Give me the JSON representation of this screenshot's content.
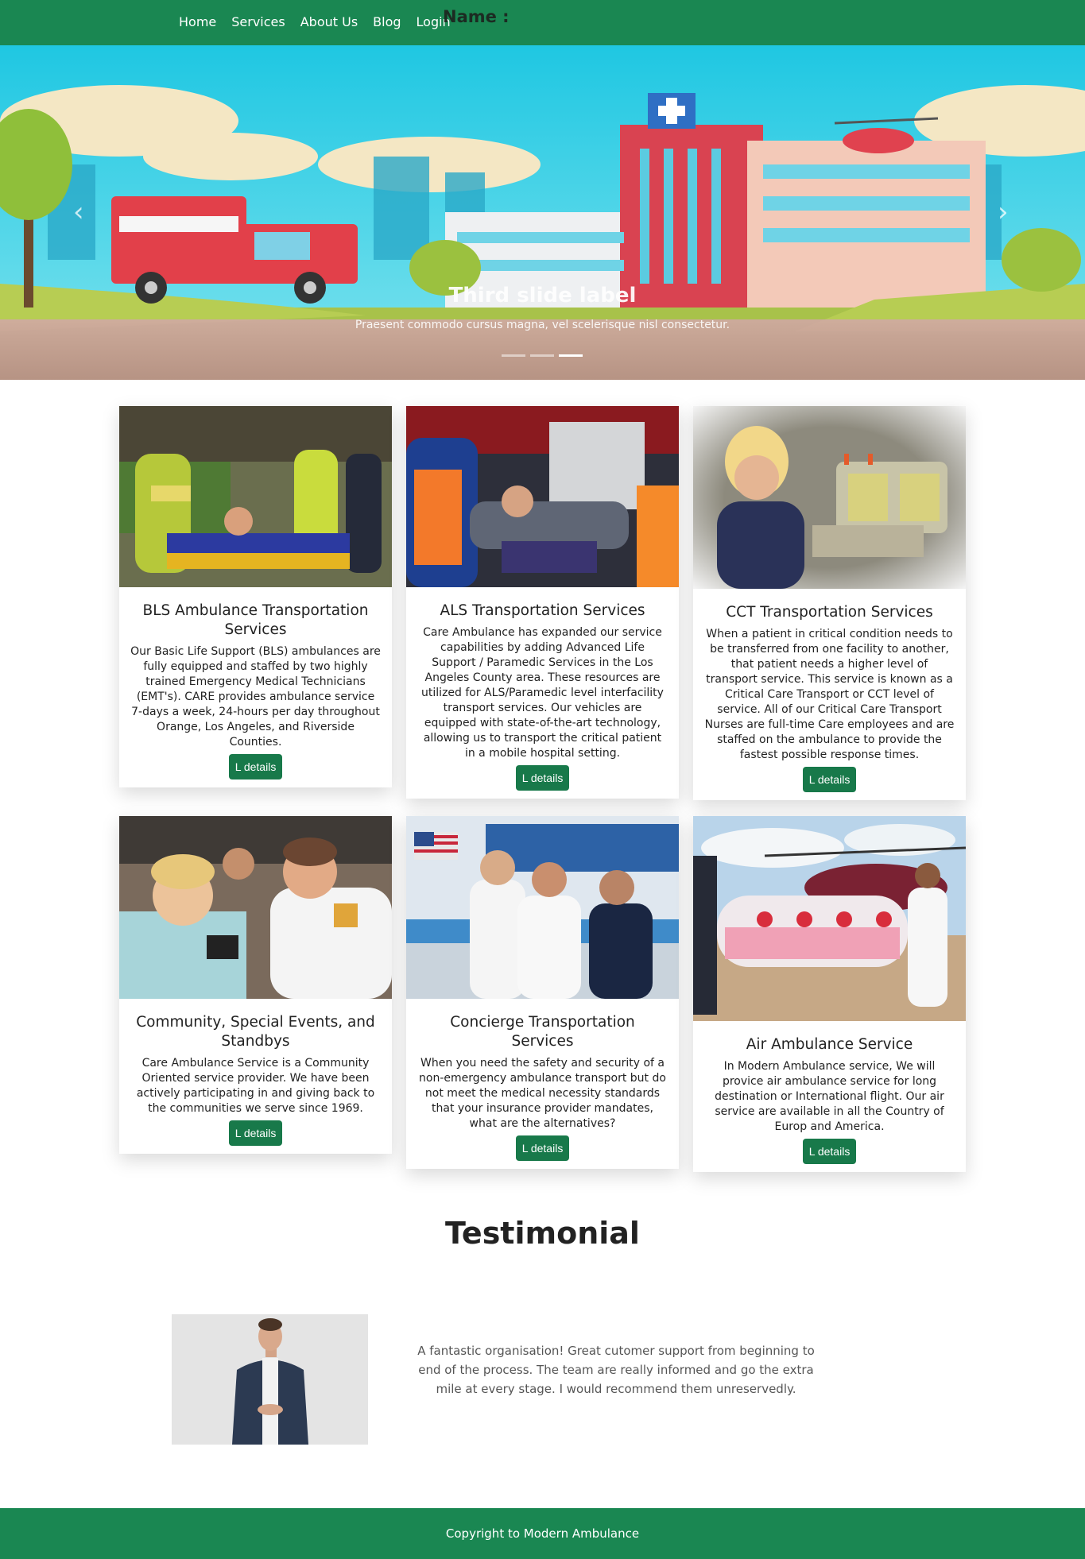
{
  "navbar": {
    "links": [
      "Home",
      "Services",
      "About Us",
      "Blog",
      "Login"
    ],
    "name_label": "Name :"
  },
  "carousel": {
    "title": "Third slide label",
    "text": "Praesent commodo cursus magna, vel scelerisque nisl consectetur.",
    "prev_icon": "chevron-left-icon",
    "next_icon": "chevron-right-icon",
    "slides": 3,
    "active_slide": 3
  },
  "cards": [
    {
      "title": "BLS Ambulance Transportation Services",
      "text": "Our Basic Life Support (BLS) ambulances are fully equipped and staffed by two highly trained Emergency Medical Technicians (EMT's). CARE provides ambulance service 7-days a week, 24-hours per day throughout Orange, Los Angeles, and Riverside Counties.",
      "button": "L details"
    },
    {
      "title": "ALS Transportation Services",
      "text": "Care Ambulance has expanded our service capabilities by adding Advanced Life Support / Paramedic Services in the Los Angeles County area. These resources are utilized for ALS/Paramedic level interfacility transport services. Our vehicles are equipped with state-of-the-art technology, allowing us to transport the critical patient in a mobile hospital setting.",
      "button": "L details"
    },
    {
      "title": "CCT Transportation Services",
      "text": "When a patient in critical condition needs to be transferred from one facility to another, that patient needs a higher level of transport service. This service is known as a Critical Care Transport or CCT level of service. All of our Critical Care Transport Nurses are full-time Care employees and are staffed on the ambulance to provide the fastest possible response times.",
      "button": "L details"
    },
    {
      "title": "Community, Special Events, and Standbys",
      "text": "Care Ambulance Service is a Community Oriented service provider. We have been actively participating in and giving back to the communities we serve since 1969.",
      "button": "L details"
    },
    {
      "title": "Concierge Transportation Services",
      "text": "When you need the safety and security of a non-emergency ambulance transport but do not meet the medical necessity standards that your insurance provider mandates, what are the alternatives?",
      "button": "L details"
    },
    {
      "title": "Air Ambulance Service",
      "text": "In Modern Ambulance service, We will provice air ambulance service for long destination or International flight. Our air service are available in all the Country of Europ and America.",
      "button": "L details"
    }
  ],
  "testimonial": {
    "heading": "Testimonial",
    "quote": "A fantastic organisation! Great cutomer support from beginning to end of the process. The team are really informed and go the extra mile at every stage. I would recommend them unreservedly."
  },
  "footer": {
    "text": "Copyright to Modern Ambulance"
  },
  "colors": {
    "brand_green": "#1a8752",
    "button_green": "#18794a"
  }
}
